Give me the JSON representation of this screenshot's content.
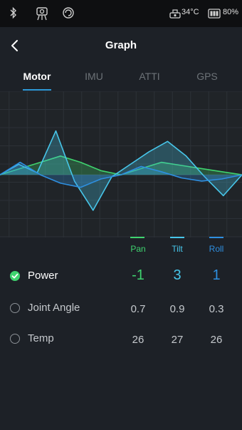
{
  "status_bar": {
    "temperature": "34°C",
    "battery": "80%",
    "icons": [
      "bluetooth-icon",
      "gimbal-camera-icon",
      "stabilizer-mode-icon",
      "device-temp-icon",
      "battery-icon"
    ]
  },
  "header": {
    "back_icon": "chevron-left-icon",
    "title": "Graph"
  },
  "tabs": [
    {
      "label": "Motor",
      "active": true
    },
    {
      "label": "IMU",
      "active": false
    },
    {
      "label": "ATTI",
      "active": false
    },
    {
      "label": "GPS",
      "active": false
    }
  ],
  "legend": {
    "pan": {
      "label": "Pan",
      "color": "#3fd36f"
    },
    "tilt": {
      "label": "Tilt",
      "color": "#47c6ea"
    },
    "roll": {
      "label": "Roll",
      "color": "#2e8fe0"
    }
  },
  "rows": [
    {
      "label": "Power",
      "selected": true,
      "pan": "-1",
      "tilt": "3",
      "roll": "1"
    },
    {
      "label": "Joint Angle",
      "selected": false,
      "pan": "0.7",
      "tilt": "0.9",
      "roll": "0.3"
    },
    {
      "label": "Temp",
      "selected": false,
      "pan": "26",
      "tilt": "27",
      "roll": "26"
    }
  ],
  "chart_data": {
    "type": "line",
    "x": [
      0,
      1,
      2,
      3,
      4,
      5,
      6,
      7,
      8,
      9,
      10,
      11,
      12,
      13,
      14
    ],
    "series": [
      {
        "name": "Pan",
        "color": "#3fd36f",
        "values": [
          0,
          0.3,
          0.6,
          0.9,
          0.6,
          0.2,
          0,
          0.3,
          0.6,
          0.45,
          0.3,
          0.15,
          0
        ]
      },
      {
        "name": "Tilt",
        "color": "#47c6ea",
        "values": [
          0,
          0.5,
          0.1,
          2.1,
          -0.3,
          -1.7,
          -0.1,
          0.5,
          1.1,
          1.6,
          0.9,
          -0.1,
          -1.0,
          0
        ]
      },
      {
        "name": "Roll",
        "color": "#2e8fe0",
        "values": [
          0,
          0.6,
          0,
          -0.4,
          -0.6,
          -0.2,
          0,
          0.4,
          0.15,
          -0.15,
          -0.3,
          -0.2,
          0
        ]
      }
    ],
    "ylim": [
      -3,
      4
    ],
    "grid": true
  }
}
